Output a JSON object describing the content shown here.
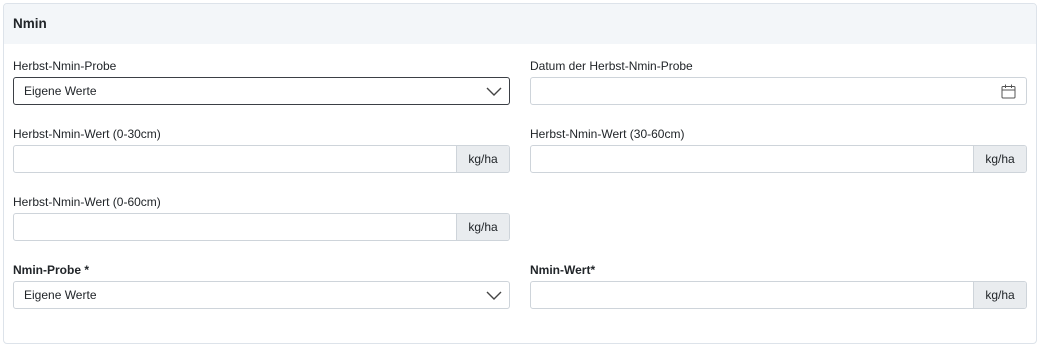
{
  "section": {
    "title": "Nmin"
  },
  "fields": {
    "herbst_probe": {
      "label": "Herbst-Nmin-Probe",
      "value": "Eigene Werte"
    },
    "datum": {
      "label": "Datum der Herbst-Nmin-Probe",
      "value": "",
      "icon": "calendar-icon"
    },
    "wert_0_30": {
      "label": "Herbst-Nmin-Wert (0-30cm)",
      "value": "",
      "unit": "kg/ha"
    },
    "wert_30_60": {
      "label": "Herbst-Nmin-Wert (30-60cm)",
      "value": "",
      "unit": "kg/ha"
    },
    "wert_0_60": {
      "label": "Herbst-Nmin-Wert (0-60cm)",
      "value": "",
      "unit": "kg/ha"
    },
    "nmin_probe": {
      "label": "Nmin-Probe *",
      "value": "Eigene Werte"
    },
    "nmin_wert": {
      "label": "Nmin-Wert*",
      "value": "",
      "unit": "kg/ha"
    }
  },
  "icons": {
    "dropdown": "chevron-down-icon",
    "date": "calendar-icon"
  },
  "colors": {
    "header_bg": "#f3f6f9",
    "addon_bg": "#e9ecef",
    "border": "#ced4da",
    "focus_border": "#3b3f45"
  }
}
